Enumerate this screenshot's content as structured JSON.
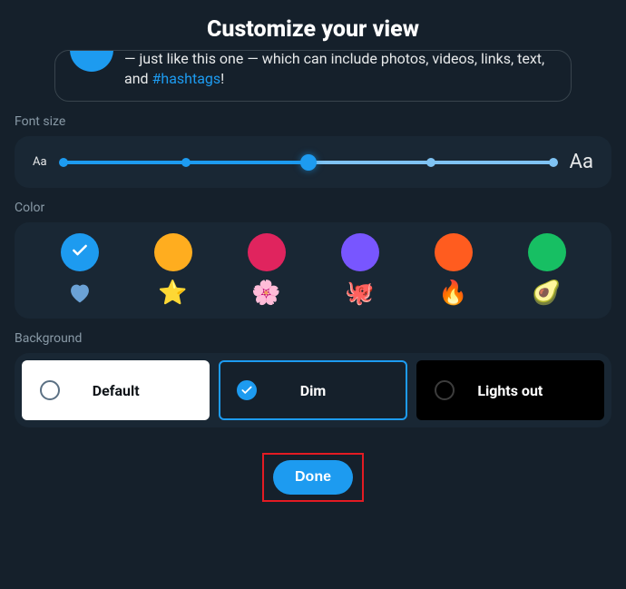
{
  "title": "Customize your view",
  "tweet": {
    "text_before": "— just like this one — which can include photos, videos, links, text, and ",
    "hashtag": "#hashtags",
    "text_after": "!"
  },
  "sections": {
    "font_size": "Font size",
    "color": "Color",
    "background": "Background"
  },
  "font_slider": {
    "small_label": "Aa",
    "large_label": "Aa",
    "steps": 5,
    "selected_index": 2
  },
  "colors": {
    "swatches": [
      {
        "name": "blue",
        "hex": "#1d9bf0",
        "selected": true
      },
      {
        "name": "yellow",
        "hex": "#ffad1f",
        "selected": false
      },
      {
        "name": "pink",
        "hex": "#e0245e",
        "selected": false
      },
      {
        "name": "purple",
        "hex": "#7856ff",
        "selected": false
      },
      {
        "name": "orange",
        "hex": "#ff5c1f",
        "selected": false
      },
      {
        "name": "green",
        "hex": "#17bf63",
        "selected": false
      }
    ],
    "emojis": [
      "heart",
      "⭐",
      "🌸",
      "🐙",
      "🔥",
      "🥑"
    ]
  },
  "backgrounds": {
    "options": [
      {
        "key": "default",
        "label": "Default",
        "selected": false
      },
      {
        "key": "dim",
        "label": "Dim",
        "selected": true
      },
      {
        "key": "lightsout",
        "label": "Lights out",
        "selected": false
      }
    ]
  },
  "done_label": "Done"
}
